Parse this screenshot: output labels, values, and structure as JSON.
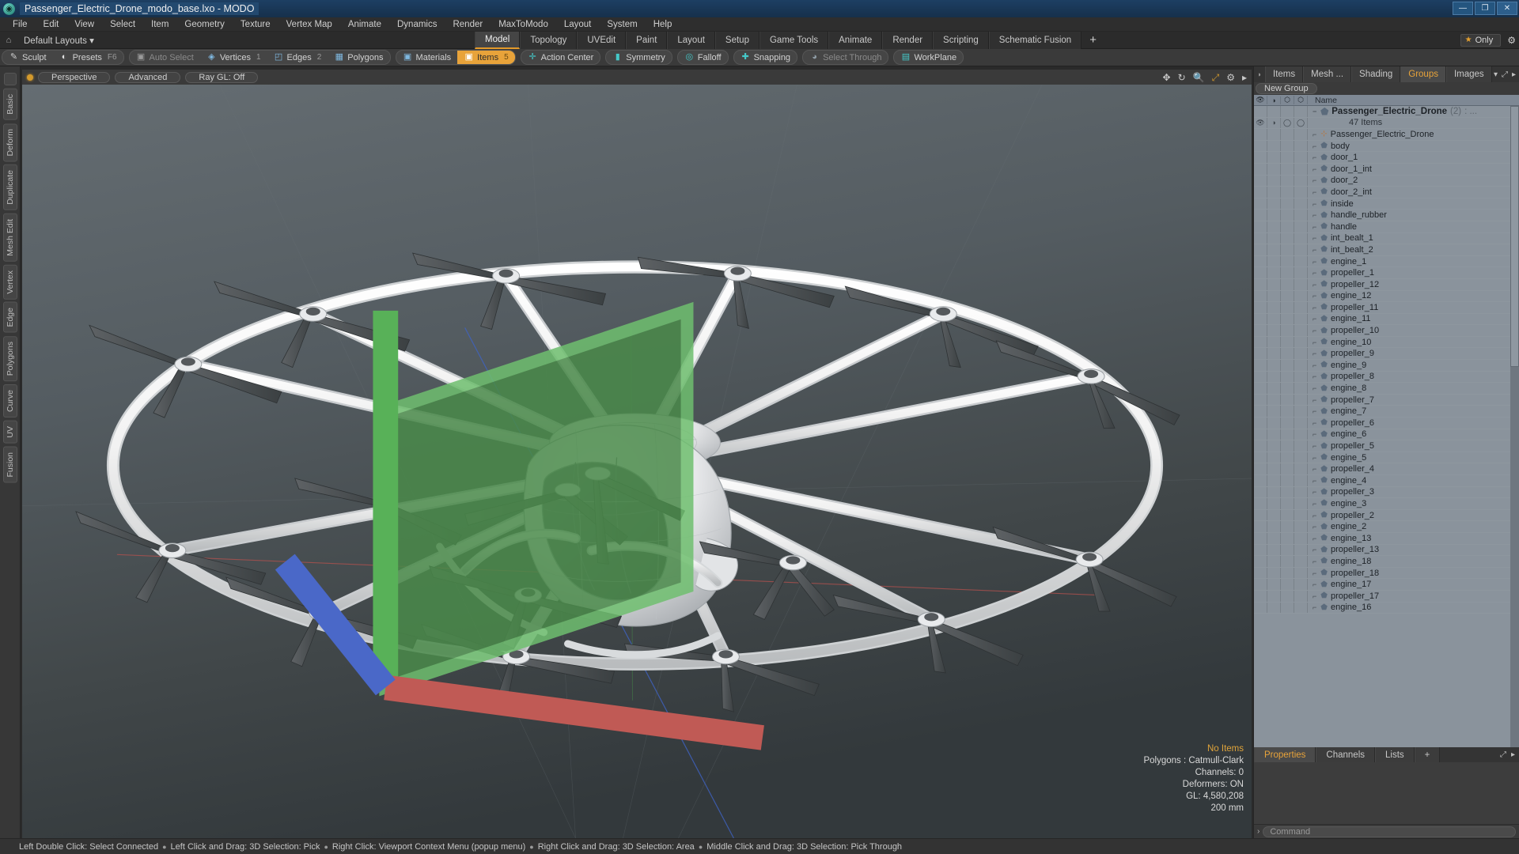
{
  "window": {
    "title": "Passenger_Electric_Drone_modo_base.lxo - MODO",
    "app_icon": "modo-icon",
    "minimize": "—",
    "maximize": "❐",
    "close": "✕"
  },
  "menubar": {
    "items": [
      "File",
      "Edit",
      "View",
      "Select",
      "Item",
      "Geometry",
      "Texture",
      "Vertex Map",
      "Animate",
      "Dynamics",
      "Render",
      "MaxToModo",
      "Layout",
      "System",
      "Help"
    ]
  },
  "layout_row": {
    "home_icon": "home-icon",
    "default_layouts": "Default Layouts",
    "dropdown_caret": "▾",
    "tabs": [
      "Model",
      "Topology",
      "UVEdit",
      "Paint",
      "Layout",
      "Setup",
      "Game Tools",
      "Animate",
      "Render",
      "Scripting",
      "Schematic Fusion"
    ],
    "active_tab": "Model",
    "add_tab": "+",
    "only_label": "Only",
    "star_icon": "star-icon",
    "gear_icon": "gear-icon"
  },
  "modebar": {
    "groups": [
      {
        "buttons": [
          {
            "label": "Sculpt",
            "icon": "sculpt-icon",
            "state": "normal",
            "num": ""
          },
          {
            "label": "Presets",
            "icon": "presets-icon",
            "state": "normal",
            "num": "F6"
          }
        ]
      },
      {
        "buttons": [
          {
            "label": "Auto Select",
            "icon": "cube-grey-icon",
            "state": "dim",
            "num": ""
          },
          {
            "label": "Vertices",
            "icon": "vertices-icon",
            "state": "normal",
            "num": "1"
          },
          {
            "label": "Edges",
            "icon": "edges-icon",
            "state": "normal",
            "num": "2"
          },
          {
            "label": "Polygons",
            "icon": "polygons-icon",
            "state": "normal",
            "num": ""
          }
        ]
      },
      {
        "buttons": [
          {
            "label": "Materials",
            "icon": "materials-icon",
            "state": "normal",
            "num": ""
          },
          {
            "label": "Items",
            "icon": "items-icon",
            "state": "on",
            "num": "5"
          }
        ]
      },
      {
        "buttons": [
          {
            "label": "Action Center",
            "icon": "action-center-icon",
            "state": "normal",
            "num": ""
          }
        ]
      },
      {
        "buttons": [
          {
            "label": "Symmetry",
            "icon": "symmetry-icon",
            "state": "normal",
            "num": ""
          }
        ]
      },
      {
        "buttons": [
          {
            "label": "Falloff",
            "icon": "falloff-icon",
            "state": "normal",
            "num": ""
          }
        ]
      },
      {
        "buttons": [
          {
            "label": "Snapping",
            "icon": "snapping-icon",
            "state": "normal",
            "num": ""
          }
        ]
      },
      {
        "buttons": [
          {
            "label": "Select Through",
            "icon": "select-through-icon",
            "state": "dim",
            "num": ""
          }
        ]
      },
      {
        "buttons": [
          {
            "label": "WorkPlane",
            "icon": "workplane-icon",
            "state": "normal",
            "num": ""
          }
        ]
      }
    ]
  },
  "left_tabs": [
    "Basic",
    "Deform",
    "Duplicate",
    "Mesh Edit",
    "Vertex",
    "Edge",
    "Polygons",
    "Curve",
    "UV",
    "Fusion"
  ],
  "viewport": {
    "indicator": "active-dot",
    "view_mode": "Perspective",
    "shading": "Advanced",
    "raygl": "Ray GL: Off",
    "icons": [
      "move-icon",
      "rotate-icon",
      "zoom-icon",
      "fit-icon",
      "gear-icon",
      "expand-arrow-icon"
    ],
    "stats": {
      "selection": "No Items",
      "polygons": "Polygons : Catmull-Clark",
      "channels": "Channels: 0",
      "deformers": "Deformers: ON",
      "gl": "GL: 4,580,208",
      "grid": "200 mm"
    }
  },
  "right_panel": {
    "tabs": [
      "Items",
      "Mesh ...",
      "Shading",
      "Groups",
      "Images"
    ],
    "active_tab": "Groups",
    "tab_end_icons": [
      "chevron-down-icon",
      "expand-icon",
      "play-icon"
    ],
    "new_group_button": "New Group",
    "list_headers": {
      "visibility": "eye-icon",
      "render": "render-icon",
      "lock": "lock-icon",
      "select": "select-icon",
      "name": "Name"
    },
    "group": {
      "name": "Passenger_Electric_Drone",
      "count": "(2)",
      "suffix": ": ...",
      "sub_count": "47 Items"
    },
    "items": [
      {
        "name": "Passenger_Electric_Drone",
        "icon": "locator-icon"
      },
      {
        "name": "body",
        "icon": "mesh-icon"
      },
      {
        "name": "door_1",
        "icon": "mesh-icon"
      },
      {
        "name": "door_1_int",
        "icon": "mesh-icon"
      },
      {
        "name": "door_2",
        "icon": "mesh-icon"
      },
      {
        "name": "door_2_int",
        "icon": "mesh-icon"
      },
      {
        "name": "inside",
        "icon": "mesh-icon"
      },
      {
        "name": "handle_rubber",
        "icon": "mesh-icon"
      },
      {
        "name": "handle",
        "icon": "mesh-icon"
      },
      {
        "name": "int_bealt_1",
        "icon": "mesh-icon"
      },
      {
        "name": "int_bealt_2",
        "icon": "mesh-icon"
      },
      {
        "name": "engine_1",
        "icon": "mesh-icon"
      },
      {
        "name": "propeller_1",
        "icon": "mesh-icon"
      },
      {
        "name": "propeller_12",
        "icon": "mesh-icon"
      },
      {
        "name": "engine_12",
        "icon": "mesh-icon"
      },
      {
        "name": "propeller_11",
        "icon": "mesh-icon"
      },
      {
        "name": "engine_11",
        "icon": "mesh-icon"
      },
      {
        "name": "propeller_10",
        "icon": "mesh-icon"
      },
      {
        "name": "engine_10",
        "icon": "mesh-icon"
      },
      {
        "name": "propeller_9",
        "icon": "mesh-icon"
      },
      {
        "name": "engine_9",
        "icon": "mesh-icon"
      },
      {
        "name": "propeller_8",
        "icon": "mesh-icon"
      },
      {
        "name": "engine_8",
        "icon": "mesh-icon"
      },
      {
        "name": "propeller_7",
        "icon": "mesh-icon"
      },
      {
        "name": "engine_7",
        "icon": "mesh-icon"
      },
      {
        "name": "propeller_6",
        "icon": "mesh-icon"
      },
      {
        "name": "engine_6",
        "icon": "mesh-icon"
      },
      {
        "name": "propeller_5",
        "icon": "mesh-icon"
      },
      {
        "name": "engine_5",
        "icon": "mesh-icon"
      },
      {
        "name": "propeller_4",
        "icon": "mesh-icon"
      },
      {
        "name": "engine_4",
        "icon": "mesh-icon"
      },
      {
        "name": "propeller_3",
        "icon": "mesh-icon"
      },
      {
        "name": "engine_3",
        "icon": "mesh-icon"
      },
      {
        "name": "propeller_2",
        "icon": "mesh-icon"
      },
      {
        "name": "engine_2",
        "icon": "mesh-icon"
      },
      {
        "name": "engine_13",
        "icon": "mesh-icon"
      },
      {
        "name": "propeller_13",
        "icon": "mesh-icon"
      },
      {
        "name": "engine_18",
        "icon": "mesh-icon"
      },
      {
        "name": "propeller_18",
        "icon": "mesh-icon"
      },
      {
        "name": "engine_17",
        "icon": "mesh-icon"
      },
      {
        "name": "propeller_17",
        "icon": "mesh-icon"
      },
      {
        "name": "engine_16",
        "icon": "mesh-icon"
      }
    ]
  },
  "properties_panel": {
    "tabs": [
      "Properties",
      "Channels",
      "Lists"
    ],
    "active_tab": "Properties",
    "add_tab": "+",
    "end_icons": [
      "expand-icon",
      "play-icon"
    ]
  },
  "command_line": {
    "arrow": "›",
    "placeholder": "Command"
  },
  "statusbar": {
    "hints": [
      "Left Double Click: Select Connected",
      "Left Click and Drag: 3D Selection: Pick",
      "Right Click: Viewport Context Menu (popup menu)",
      "Right Click and Drag: 3D Selection: Area",
      "Middle Click and Drag: 3D Selection: Pick Through"
    ],
    "separator": "●"
  },
  "colors": {
    "accent_orange": "#e8a33a",
    "title_blue": "#1d3f63",
    "panel_grey": "#3a3a3a",
    "list_grey": "#8a939c"
  }
}
